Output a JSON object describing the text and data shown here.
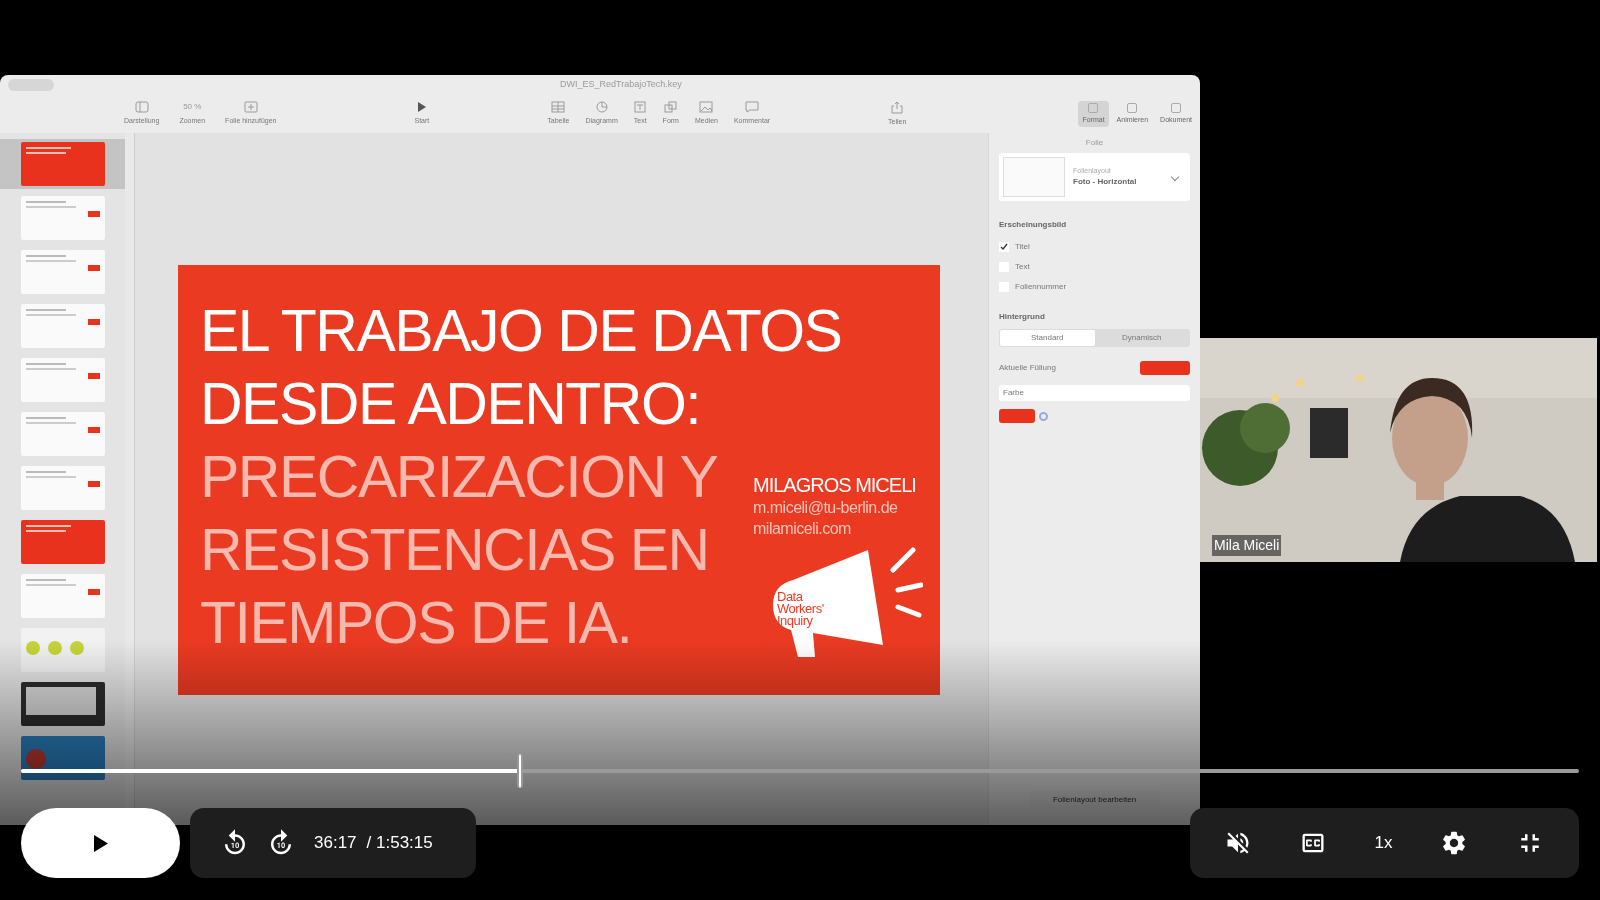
{
  "keynote": {
    "title": "DWI_ES_RedTrabajoTech.key",
    "zoom": "50 %",
    "toolbar_left": [
      {
        "label": "Darstellung",
        "kind": "sidebar"
      },
      {
        "label": "Zoomen",
        "kind": "zoom"
      },
      {
        "label": "Folie hinzufügen",
        "kind": "add"
      }
    ],
    "toolbar_center": [
      {
        "label": "Start",
        "kind": "play"
      }
    ],
    "toolbar_insert": [
      {
        "label": "Tabelle",
        "kind": "table"
      },
      {
        "label": "Diagramm",
        "kind": "chart"
      },
      {
        "label": "Text",
        "kind": "text"
      },
      {
        "label": "Form",
        "kind": "shape"
      },
      {
        "label": "Medien",
        "kind": "media"
      },
      {
        "label": "Kommentar",
        "kind": "comment"
      }
    ],
    "toolbar_share": [
      {
        "label": "Teilen",
        "kind": "share"
      }
    ],
    "inspector_tabs": [
      {
        "label": "Format",
        "selected": true
      },
      {
        "label": "Animieren",
        "selected": false
      },
      {
        "label": "Dokument",
        "selected": false
      }
    ],
    "slides": [
      {
        "kind": "red",
        "selected": true
      },
      {
        "kind": "white",
        "selected": false
      },
      {
        "kind": "white",
        "selected": false
      },
      {
        "kind": "white",
        "selected": false
      },
      {
        "kind": "white",
        "selected": false
      },
      {
        "kind": "white",
        "selected": false
      },
      {
        "kind": "white",
        "selected": false
      },
      {
        "kind": "red",
        "selected": false
      },
      {
        "kind": "white",
        "selected": false
      },
      {
        "kind": "yellow",
        "selected": false
      },
      {
        "kind": "dark",
        "selected": false
      },
      {
        "kind": "blue",
        "selected": false
      }
    ],
    "slide": {
      "lines": [
        {
          "text": "EL TRABAJO DE DATOS",
          "kind": "title"
        },
        {
          "text": "DESDE ADENTRO:",
          "kind": "title"
        },
        {
          "text": "PRECARIZACION Y",
          "kind": "subtitle"
        },
        {
          "text": "RESISTENCIAS EN",
          "kind": "subtitle"
        },
        {
          "text": "TIEMPOS DE IA.",
          "kind": "subtitle"
        }
      ],
      "author": "MILAGROS MICELI",
      "email": "m.miceli@tu-berlin.de",
      "website": "milamiceli.com",
      "logo_text": "Data Workers' Inquiry"
    },
    "inspector": {
      "header": "Folie",
      "layout_label": "Folienlayout",
      "layout_value": "Foto - Horizontal",
      "appearance_title": "Erscheinungsbild",
      "appearance": [
        {
          "label": "Titel",
          "checked": true
        },
        {
          "label": "Text",
          "checked": false
        },
        {
          "label": "Foliennummer",
          "checked": false
        }
      ],
      "background_title": "Hintergrund",
      "background_modes": [
        {
          "label": "Standard",
          "selected": true
        },
        {
          "label": "Dynamisch",
          "selected": false
        }
      ],
      "fill_label": "Aktuelle Füllung",
      "fill_type": "Farbe",
      "edit_button": "Folienlayout bearbeiten"
    }
  },
  "webcam": {
    "name": "Mila Miceli"
  },
  "player": {
    "progress": {
      "level": 0.32
    },
    "current_time": "36:17",
    "duration": "/ 1:53:15",
    "speed": "1x",
    "muted": true
  }
}
